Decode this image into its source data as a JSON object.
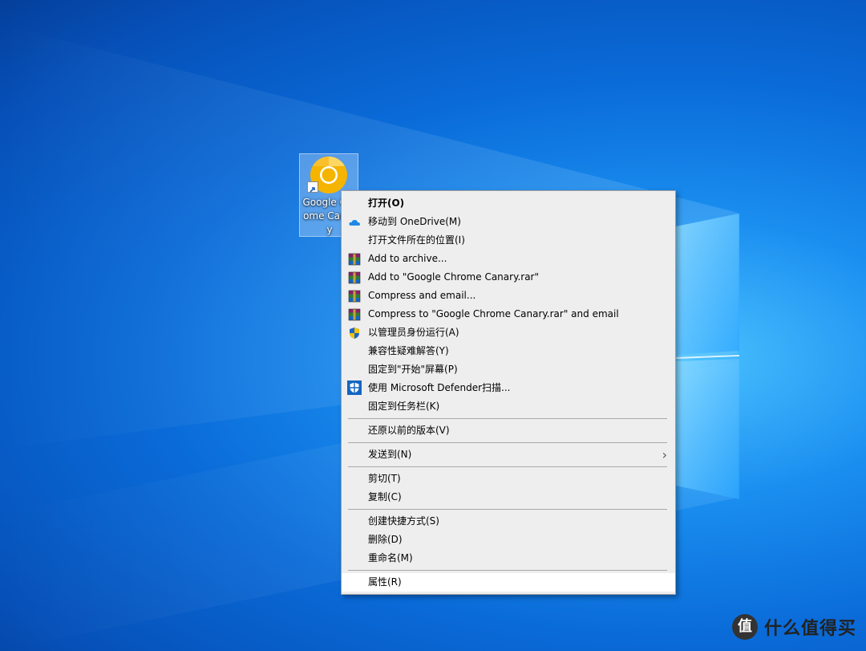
{
  "desktop": {
    "icon": {
      "label": "Google Chrome Canary",
      "icon_name": "chrome-canary-icon"
    }
  },
  "context_menu": {
    "groups": [
      [
        {
          "label": "打开(O)",
          "bold": true,
          "icon": ""
        },
        {
          "label": "移动到 OneDrive(M)",
          "icon": "onedrive-icon"
        },
        {
          "label": "打开文件所在的位置(I)",
          "icon": ""
        },
        {
          "label": "Add to archive...",
          "icon": "winrar-icon"
        },
        {
          "label": "Add to \"Google Chrome Canary.rar\"",
          "icon": "winrar-icon"
        },
        {
          "label": "Compress and email...",
          "icon": "winrar-icon"
        },
        {
          "label": "Compress to \"Google Chrome Canary.rar\" and email",
          "icon": "winrar-icon"
        },
        {
          "label": "以管理员身份运行(A)",
          "icon": "uac-shield-icon"
        },
        {
          "label": "兼容性疑难解答(Y)",
          "icon": ""
        },
        {
          "label": "固定到\"开始\"屏幕(P)",
          "icon": ""
        },
        {
          "label": "使用 Microsoft Defender扫描...",
          "icon": "defender-icon"
        },
        {
          "label": "固定到任务栏(K)",
          "icon": ""
        }
      ],
      [
        {
          "label": "还原以前的版本(V)",
          "icon": ""
        }
      ],
      [
        {
          "label": "发送到(N)",
          "icon": "",
          "submenu": true
        }
      ],
      [
        {
          "label": "剪切(T)",
          "icon": ""
        },
        {
          "label": "复制(C)",
          "icon": ""
        }
      ],
      [
        {
          "label": "创建快捷方式(S)",
          "icon": ""
        },
        {
          "label": "删除(D)",
          "icon": ""
        },
        {
          "label": "重命名(M)",
          "icon": ""
        }
      ],
      [
        {
          "label": "属性(R)",
          "icon": "",
          "highlighted": true
        }
      ]
    ]
  },
  "watermark": {
    "logo_char": "值",
    "text": "什么值得买"
  },
  "colors": {
    "menu_bg": "#eeeeee",
    "desktop_accent": "#0a6bd8"
  }
}
